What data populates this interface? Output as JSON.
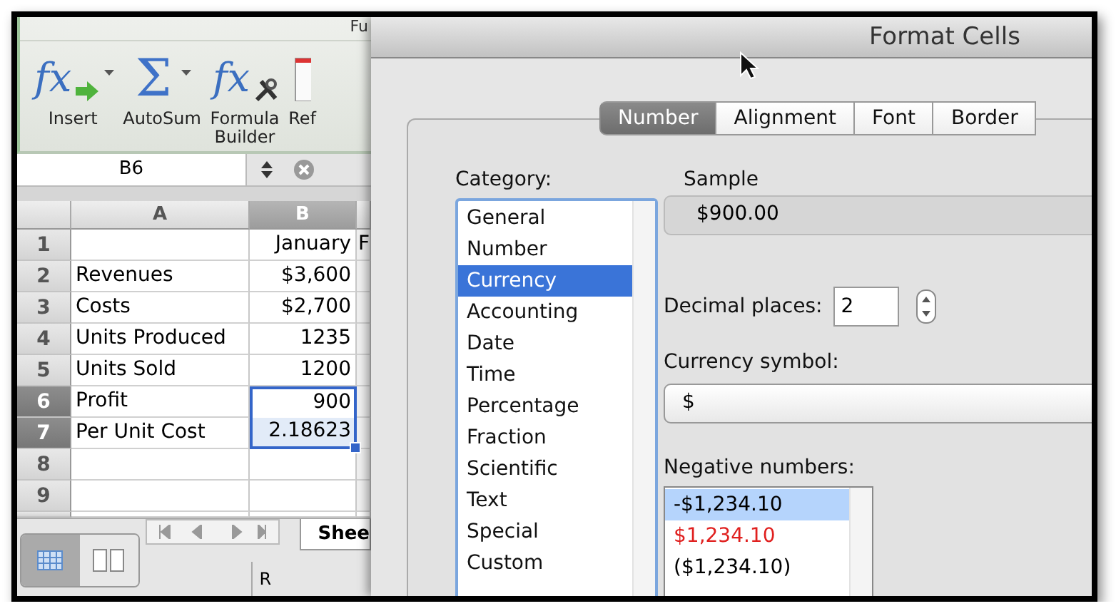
{
  "ribbon": {
    "group_title": "Fu",
    "buttons": [
      {
        "label": "Insert",
        "kind": "insert",
        "glyph": "fx",
        "menu": true
      },
      {
        "label": "AutoSum",
        "kind": "autosum",
        "glyph": "Σ",
        "menu": true
      },
      {
        "label": "Formula\nBuilder",
        "kind": "builder",
        "glyph": "fx",
        "menu": false
      },
      {
        "label": "Ref",
        "kind": "reference",
        "menu": false
      }
    ]
  },
  "formula_bar": {
    "name_box": "B6"
  },
  "sheet": {
    "columns": [
      {
        "label": "A",
        "selected": false
      },
      {
        "label": "B",
        "selected": true
      }
    ],
    "rows": [
      {
        "number": "1",
        "selected": false,
        "b": "January",
        "column_3": "F"
      },
      {
        "number": "2",
        "selected": false,
        "a": "Revenues",
        "b": "$3,600"
      },
      {
        "number": "3",
        "selected": false,
        "a": "Costs",
        "b": "$2,700"
      },
      {
        "number": "4",
        "selected": false,
        "a": "Units Produced",
        "b": "1235"
      },
      {
        "number": "5",
        "selected": false,
        "a": "Units Sold",
        "b": "1200"
      },
      {
        "number": "6",
        "selected": true,
        "a": "Profit",
        "b": "900"
      },
      {
        "number": "7",
        "selected": true,
        "a": "Per Unit Cost",
        "b": "2.18623"
      },
      {
        "number": "8",
        "selected": false
      },
      {
        "number": "9",
        "selected": false
      }
    ],
    "sheet_tab": "Shee",
    "status": "R"
  },
  "dialog": {
    "title": "Format Cells",
    "tabs": [
      {
        "label": "Number",
        "selected": true
      },
      {
        "label": "Alignment",
        "selected": false
      },
      {
        "label": "Font",
        "selected": false
      },
      {
        "label": "Border",
        "selected": false
      }
    ],
    "category_label": "Category:",
    "categories": [
      {
        "label": "General",
        "selected": false
      },
      {
        "label": "Number",
        "selected": false
      },
      {
        "label": "Currency",
        "selected": true
      },
      {
        "label": "Accounting",
        "selected": false
      },
      {
        "label": "Date",
        "selected": false
      },
      {
        "label": "Time",
        "selected": false
      },
      {
        "label": "Percentage",
        "selected": false
      },
      {
        "label": "Fraction",
        "selected": false
      },
      {
        "label": "Scientific",
        "selected": false
      },
      {
        "label": "Text",
        "selected": false
      },
      {
        "label": "Special",
        "selected": false
      },
      {
        "label": "Custom",
        "selected": false
      }
    ],
    "sample_label": "Sample",
    "sample_value": "$900.00",
    "decimal_label": "Decimal places:",
    "decimal_value": "2",
    "currency_label": "Currency symbol:",
    "currency_value": "$",
    "negative_label": "Negative numbers:",
    "negative_formats": [
      {
        "text": "-$1,234.10",
        "selected": true,
        "color": "#000000"
      },
      {
        "text": "$1,234.10",
        "selected": false,
        "color": "#e0201f"
      },
      {
        "text": "($1,234.10)",
        "selected": false,
        "color": "#000000"
      }
    ]
  }
}
